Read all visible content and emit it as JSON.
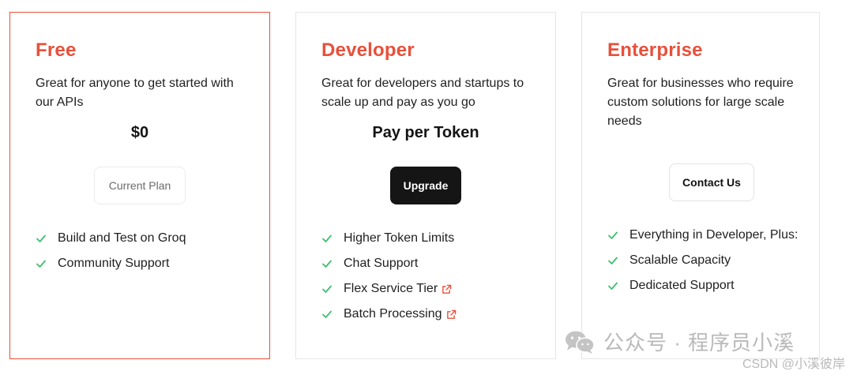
{
  "plans": [
    {
      "title": "Free",
      "description": "Great for anyone to get started with our APIs",
      "price": "$0",
      "button_label": "Current Plan",
      "features": [
        {
          "label": "Build and Test on Groq"
        },
        {
          "label": "Community Support"
        }
      ]
    },
    {
      "title": "Developer",
      "description": "Great for developers and startups to scale up and pay as you go",
      "price": "Pay per Token",
      "button_label": "Upgrade",
      "features": [
        {
          "label": "Higher Token Limits"
        },
        {
          "label": "Chat Support"
        },
        {
          "label": "Flex Service Tier",
          "icon": "external-link-icon"
        },
        {
          "label": "Batch Processing",
          "icon": "external-link-icon"
        }
      ]
    },
    {
      "title": "Enterprise",
      "description": "Great for businesses who require custom solutions for large scale needs",
      "button_label": "Contact Us",
      "features": [
        {
          "label": "Everything in Developer, Plus:"
        },
        {
          "label": "Scalable Capacity"
        },
        {
          "label": "Dedicated Support"
        }
      ]
    }
  ],
  "colors": {
    "accent": "#e8503a",
    "check": "#3fbf6f",
    "primary_button": "#151515"
  },
  "watermark": {
    "text": "公众号 · 程序员小溪",
    "icon": "wechat-icon",
    "csdn": "CSDN @小溪彼岸"
  }
}
